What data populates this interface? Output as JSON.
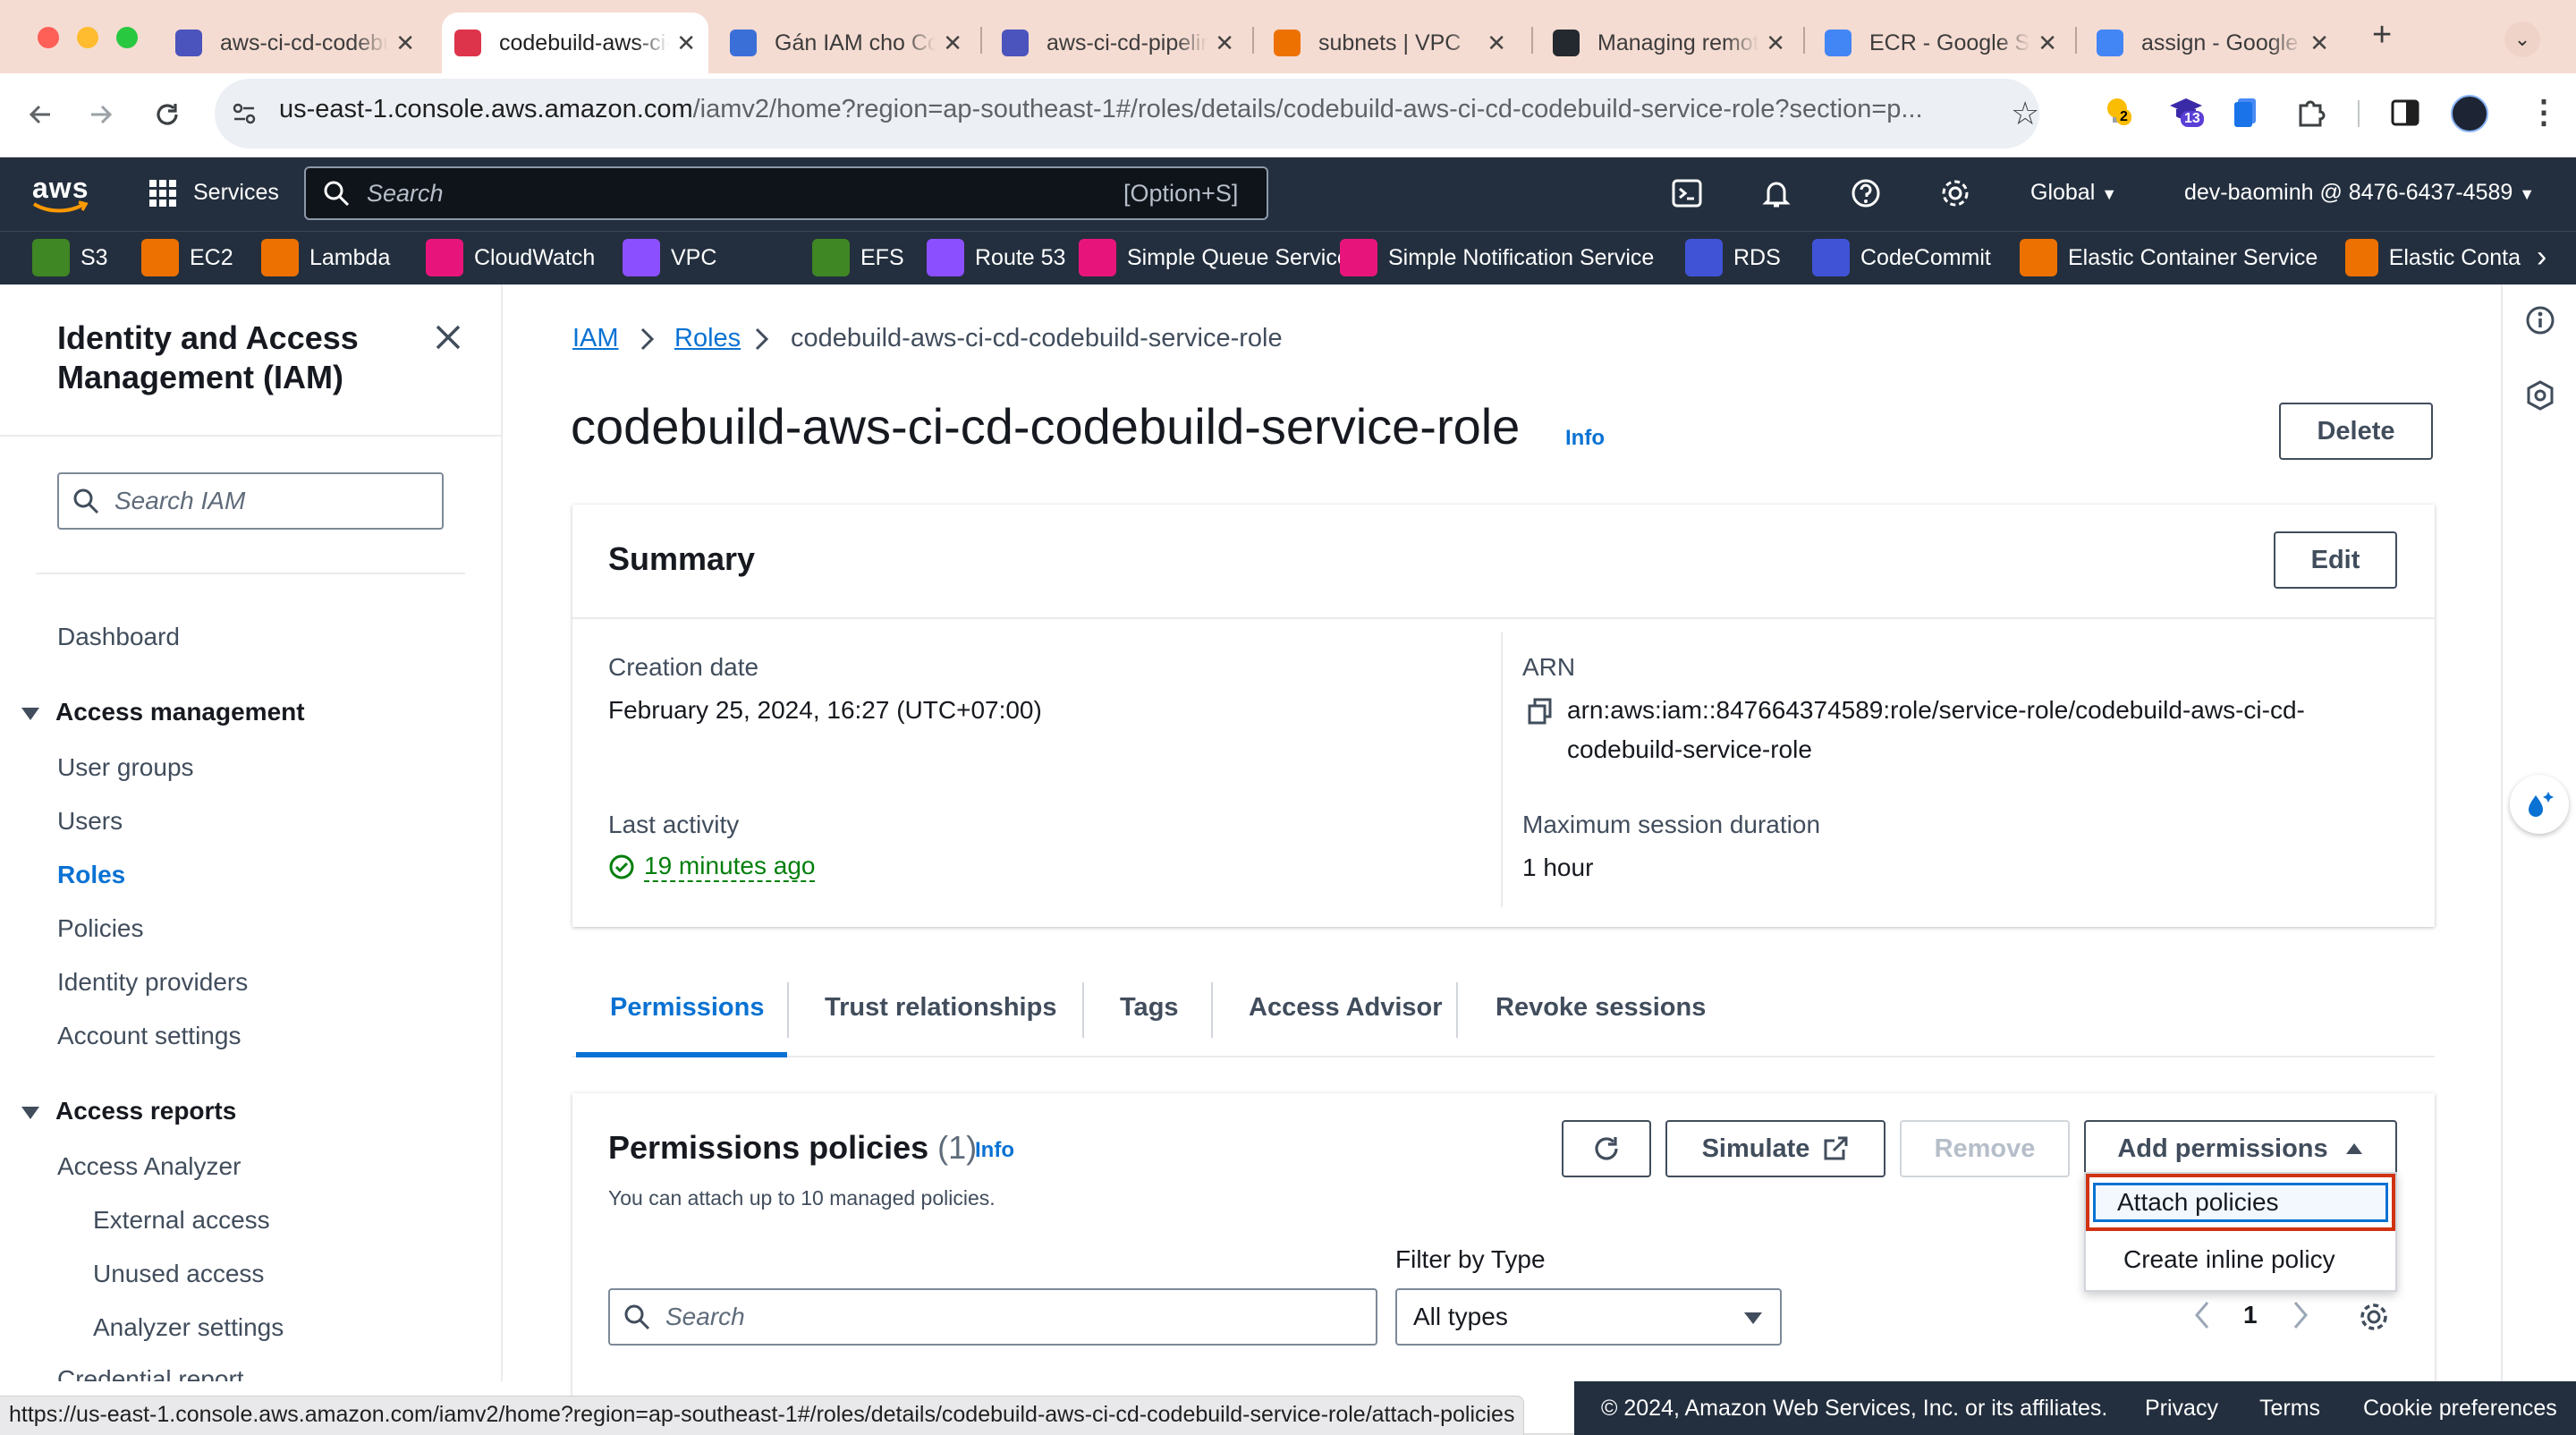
{
  "browser": {
    "tabs": [
      {
        "title": "aws-ci-cd-codebuild",
        "favicon_color": "#4b53bc",
        "active": false
      },
      {
        "title": "codebuild-aws-ci-cd",
        "favicon_color": "#dd344c",
        "active": true
      },
      {
        "title": "Gán IAM cho CodeBuild",
        "favicon_color": "#3b6fd8",
        "active": false
      },
      {
        "title": "aws-ci-cd-pipeline",
        "favicon_color": "#4b53bc",
        "active": false
      },
      {
        "title": "subnets | VPC",
        "favicon_color": "#ed7100",
        "active": false
      },
      {
        "title": "Managing remote",
        "favicon_color": "#24292f",
        "active": false
      },
      {
        "title": "ECR - Google Search",
        "favicon_color": "#4285f4",
        "active": false
      },
      {
        "title": "assign - Google Search",
        "favicon_color": "#4285f4",
        "active": false
      }
    ],
    "new_tab": "+",
    "url_host": "us-east-1.console.aws.amazon.com",
    "url_path": "/iamv2/home?region=ap-southeast-1#/roles/details/codebuild-aws-ci-cd-codebuild-service-role?section=p...",
    "extension_badges": {
      "first": "2",
      "second": "13"
    },
    "status_url": "https://us-east-1.console.aws.amazon.com/iamv2/home?region=ap-southeast-1#/roles/details/codebuild-aws-ci-cd-codebuild-service-role/attach-policies"
  },
  "aws_nav": {
    "logo": "aws",
    "services_label": "Services",
    "search_placeholder": "Search",
    "search_shortcut": "[Option+S]",
    "region": "Global",
    "account": "dev-baominh @ 8476-6437-4589",
    "favorites": [
      {
        "label": "S3",
        "color": "#3f8624"
      },
      {
        "label": "EC2",
        "color": "#ed7100"
      },
      {
        "label": "Lambda",
        "color": "#ed7100"
      },
      {
        "label": "CloudWatch",
        "color": "#e7157b"
      },
      {
        "label": "VPC",
        "color": "#8c4fff"
      },
      {
        "label": "EFS",
        "color": "#3f8624"
      },
      {
        "label": "Route 53",
        "color": "#8c4fff"
      },
      {
        "label": "Simple Queue Service",
        "color": "#e7157b"
      },
      {
        "label": "Simple Notification Service",
        "color": "#e7157b"
      },
      {
        "label": "RDS",
        "color": "#4053d6"
      },
      {
        "label": "CodeCommit",
        "color": "#4053d6"
      },
      {
        "label": "Elastic Container Service",
        "color": "#ed7100"
      },
      {
        "label": "Elastic Conta",
        "color": "#ed7100"
      }
    ]
  },
  "sidenav": {
    "title": "Identity and Access Management (IAM)",
    "search_placeholder": "Search IAM",
    "dashboard": "Dashboard",
    "access_management": {
      "label": "Access management",
      "items": [
        "User groups",
        "Users",
        "Roles",
        "Policies",
        "Identity providers",
        "Account settings"
      ],
      "active": "Roles"
    },
    "access_reports": {
      "label": "Access reports",
      "analyzer": "Access Analyzer",
      "sub_items": [
        "External access",
        "Unused access",
        "Analyzer settings"
      ],
      "cut_off": "Credential report"
    }
  },
  "breadcrumb": {
    "iam": "IAM",
    "roles": "Roles",
    "current": "codebuild-aws-ci-cd-codebuild-service-role"
  },
  "page": {
    "title": "codebuild-aws-ci-cd-codebuild-service-role",
    "info": "Info",
    "delete_button": "Delete"
  },
  "summary": {
    "title": "Summary",
    "edit_button": "Edit",
    "creation_date_label": "Creation date",
    "creation_date": "February 25, 2024, 16:27 (UTC+07:00)",
    "arn_label": "ARN",
    "arn_line1": "arn:aws:iam::847664374589:role/service-role/codebuild-aws-ci-cd-",
    "arn_line2": "codebuild-service-role",
    "last_activity_label": "Last activity",
    "last_activity": "19 minutes ago",
    "max_session_label": "Maximum session duration",
    "max_session": "1 hour"
  },
  "tabs": [
    "Permissions",
    "Trust relationships",
    "Tags",
    "Access Advisor",
    "Revoke sessions"
  ],
  "permissions": {
    "title": "Permissions policies",
    "count": "(1)",
    "info": "Info",
    "description": "You can attach up to 10 managed policies.",
    "simulate_button": "Simulate",
    "remove_button": "Remove",
    "add_permissions_button": "Add permissions",
    "dropdown": [
      "Attach policies",
      "Create inline policy"
    ],
    "filter_label": "Filter by Type",
    "search_placeholder": "Search",
    "filter_value": "All types",
    "page_number": "1"
  },
  "footer": {
    "copyright": "© 2024, Amazon Web Services, Inc. or its affiliates.",
    "privacy": "Privacy",
    "terms": "Terms",
    "cookie": "Cookie preferences"
  }
}
